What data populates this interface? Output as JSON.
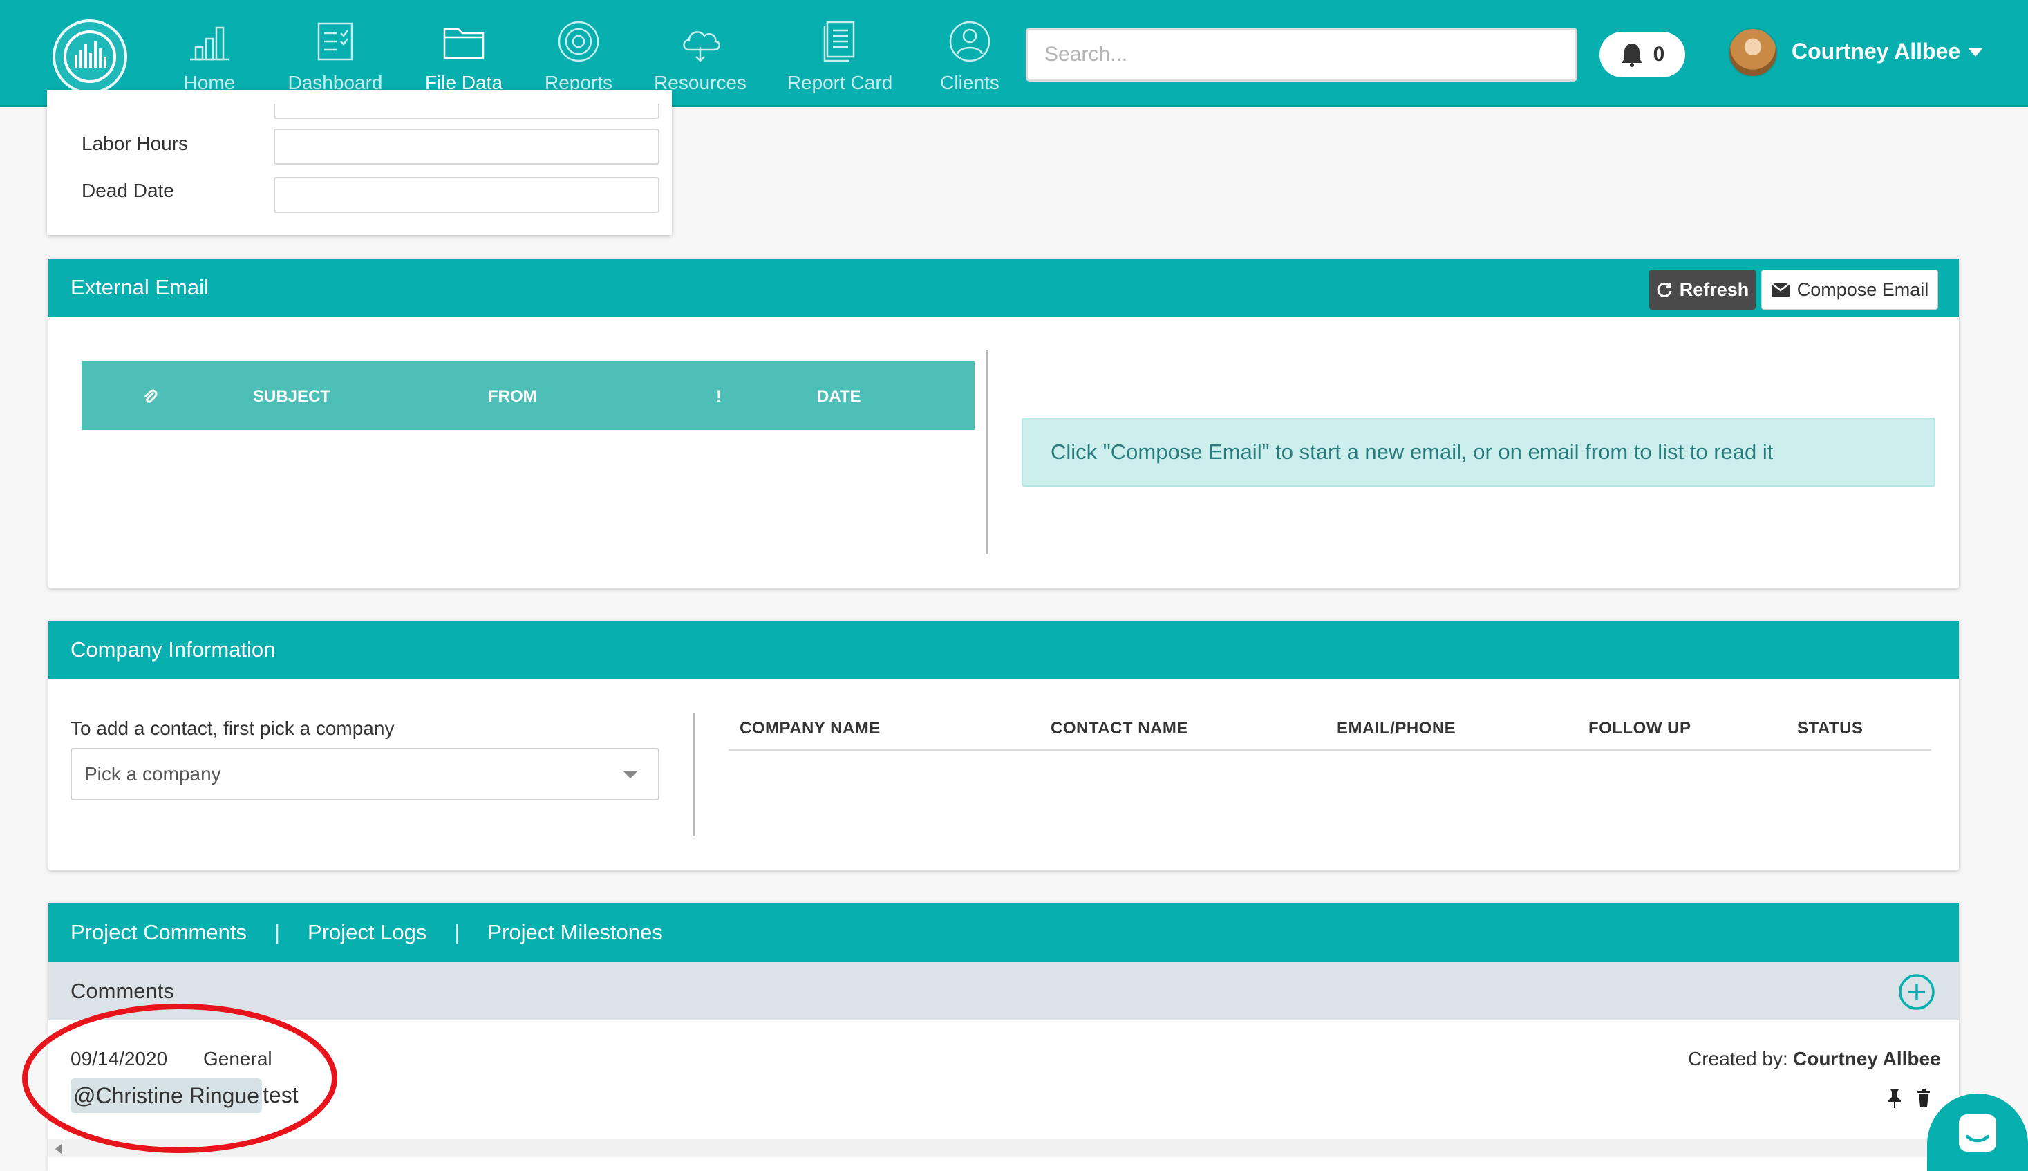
{
  "nav": {
    "items": [
      {
        "id": "home",
        "label": "Home",
        "icon": "bar-chart-icon"
      },
      {
        "id": "dashboard",
        "label": "Dashboard",
        "icon": "checklist-icon"
      },
      {
        "id": "file-data",
        "label": "File Data",
        "icon": "folder-icon",
        "active": true
      },
      {
        "id": "reports",
        "label": "Reports",
        "icon": "target-icon"
      },
      {
        "id": "resources",
        "label": "Resources",
        "icon": "cloud-icon"
      },
      {
        "id": "report-card",
        "label": "Report Card",
        "icon": "document-stack-icon"
      },
      {
        "id": "clients",
        "label": "Clients",
        "icon": "user-circle-icon"
      }
    ],
    "search_placeholder": "Search...",
    "notification_count": "0",
    "user_name": "Courtney Allbee"
  },
  "project_fields": {
    "labor_hours_label": "Labor Hours",
    "dead_date_label": "Dead Date",
    "labor_hours_value": "",
    "dead_date_value": ""
  },
  "external_email": {
    "title": "External Email",
    "refresh_label": "Refresh",
    "compose_label": "Compose Email",
    "columns": {
      "attachment": "attachment-icon",
      "subject": "SUBJECT",
      "from": "FROM",
      "priority": "!",
      "date": "DATE"
    },
    "hint": "Click \"Compose Email\" to start a new email, or on email from to list to read it"
  },
  "company_info": {
    "title": "Company Information",
    "helper_text": "To add a contact, first pick a company",
    "select_placeholder": "Pick a company",
    "columns": [
      "COMPANY NAME",
      "CONTACT NAME",
      "EMAIL/PHONE",
      "FOLLOW UP",
      "STATUS"
    ]
  },
  "project_tabs": {
    "tabs": [
      "Project Comments",
      "Project Logs",
      "Project Milestones"
    ],
    "separator": "|",
    "comments_title": "Comments",
    "comment": {
      "date": "09/14/2020",
      "category": "General",
      "created_by_label": "Created by:",
      "created_by": "Courtney Allbee",
      "mention": "@Christine Ringue",
      "text": "test"
    }
  },
  "colors": {
    "brand": "#08afaf",
    "table_header": "#4dbfb7",
    "info_box": "#ccefee",
    "highlight_ring": "#e8141b"
  }
}
